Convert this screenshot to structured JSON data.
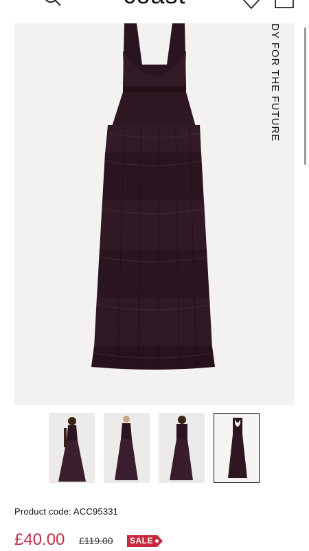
{
  "header": {
    "logo": "coast",
    "bag_count": "0",
    "icons": {
      "menu": "hamburger-menu-icon",
      "search": "search-icon",
      "wishlist": "heart-icon",
      "bag": "shopping-bag-icon"
    }
  },
  "gallery": {
    "caption": "DY FOR THE FUTURE",
    "thumbnail_count": 4,
    "active_thumbnail": 4
  },
  "product": {
    "code": "Product code: ACC95331",
    "price_now": "£40.00",
    "price_was": "£119.00",
    "sale_label": "SALE"
  },
  "colors": {
    "dress": "#2a1420",
    "sale_red": "#c8283e",
    "price_red": "#c0304a",
    "image_bg": "#f3f2f1"
  }
}
